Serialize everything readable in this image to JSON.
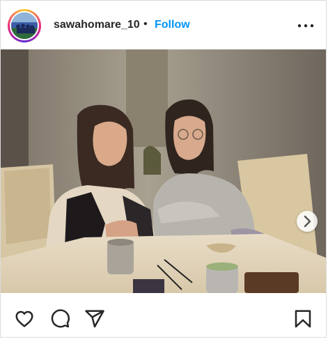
{
  "post": {
    "username": "sawahomare_10",
    "separator": "•",
    "follow_label": "Follow",
    "accent_color": "#0095f6"
  },
  "icons": {
    "more": "more-horizontal-icon",
    "next": "chevron-right-icon",
    "like": "heart-icon",
    "comment": "comment-icon",
    "share": "share-icon",
    "save": "bookmark-icon"
  }
}
